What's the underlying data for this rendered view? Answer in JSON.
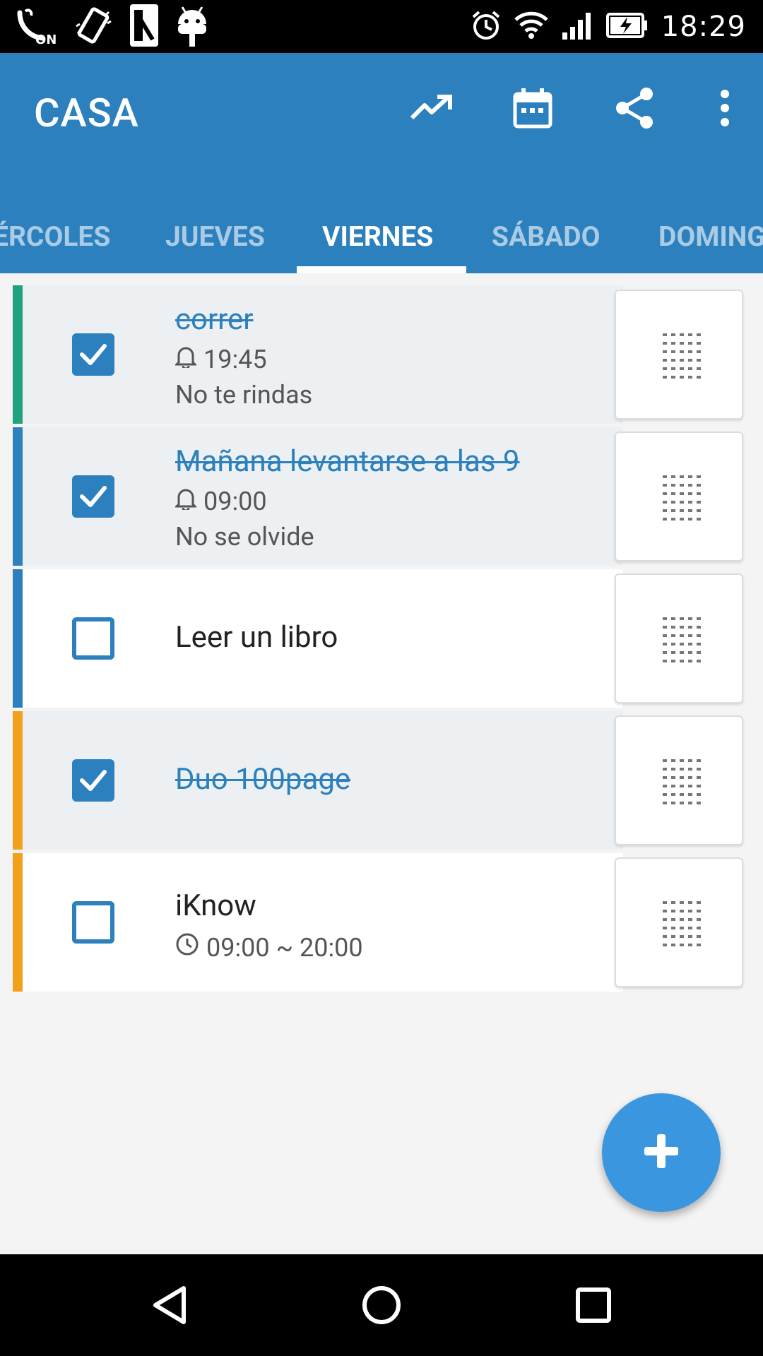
{
  "status_bar": {
    "time": "18:29",
    "icons": [
      "volte-on-icon",
      "vibrate-icon",
      "sim-icon",
      "android-debug-icon",
      "alarm-icon",
      "wifi-icon",
      "signal-icon",
      "battery-charging-icon"
    ]
  },
  "app_bar": {
    "title": "CASA",
    "actions": [
      "trending-icon",
      "calendar-icon",
      "share-icon",
      "more-vert-icon"
    ],
    "background": "#2c80bd"
  },
  "tabs": [
    {
      "label": "ÉRCOLES",
      "active": false
    },
    {
      "label": "JUEVES",
      "active": false
    },
    {
      "label": "VIERNES",
      "active": true
    },
    {
      "label": "SÁBADO",
      "active": false
    },
    {
      "label": "DOMINGO",
      "active": false
    }
  ],
  "tasks": [
    {
      "title": "correr",
      "done": true,
      "time": "19:45",
      "time_icon": "bell-icon",
      "note": "No te rindas",
      "color": "#1fa37e"
    },
    {
      "title": "Mañana levantarse a las 9",
      "done": true,
      "time": "09:00",
      "time_icon": "bell-icon",
      "note": "No se olvide",
      "color": "#2c80bd"
    },
    {
      "title": "Leer un libro",
      "done": false,
      "color": "#2c80bd"
    },
    {
      "title": "Duo 100page",
      "done": true,
      "color": "#f2a11c"
    },
    {
      "title": "iKnow",
      "done": false,
      "time": "09:00 ~ 20:00",
      "time_icon": "clock-icon",
      "color": "#f2a11c"
    }
  ],
  "fab": {
    "icon": "plus-icon",
    "color": "#3a97df"
  },
  "nav_bar": {
    "buttons": [
      "back-icon",
      "home-icon",
      "recents-icon"
    ]
  }
}
